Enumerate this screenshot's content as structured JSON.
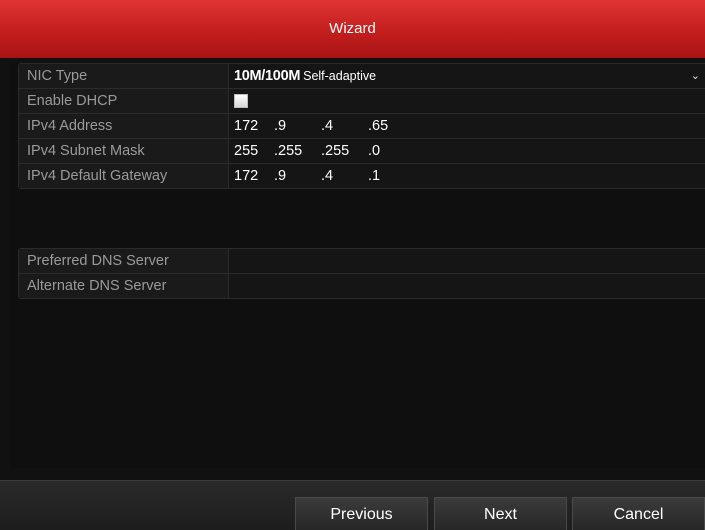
{
  "window": {
    "title": "Wizard"
  },
  "network": {
    "nic_type": {
      "label": "NIC Type",
      "value_bold": "10M/100M",
      "value_light": "Self-adaptive"
    },
    "enable_dhcp": {
      "label": "Enable DHCP",
      "checked": false
    },
    "ipv4_address": {
      "label": "IPv4 Address",
      "octets": [
        "172",
        ".9",
        ".4",
        ".65"
      ]
    },
    "subnet_mask": {
      "label": "IPv4 Subnet Mask",
      "octets": [
        "255",
        ".255",
        ".255",
        ".0"
      ]
    },
    "default_gateway": {
      "label": "IPv4 Default Gateway",
      "octets": [
        "172",
        ".9",
        ".4",
        ".1"
      ]
    }
  },
  "dns": {
    "preferred": {
      "label": "Preferred DNS Server",
      "value": ""
    },
    "alternate": {
      "label": "Alternate DNS Server",
      "value": ""
    }
  },
  "footer": {
    "previous": "Previous",
    "next": "Next",
    "cancel": "Cancel"
  },
  "colors": {
    "title_bar": "#c41e1e",
    "background": "#111111",
    "label_text": "#9a9a9a",
    "value_text": "#ffffff"
  },
  "icons": {
    "dropdown": "chevron-down-icon",
    "dhcp": "checkbox"
  }
}
